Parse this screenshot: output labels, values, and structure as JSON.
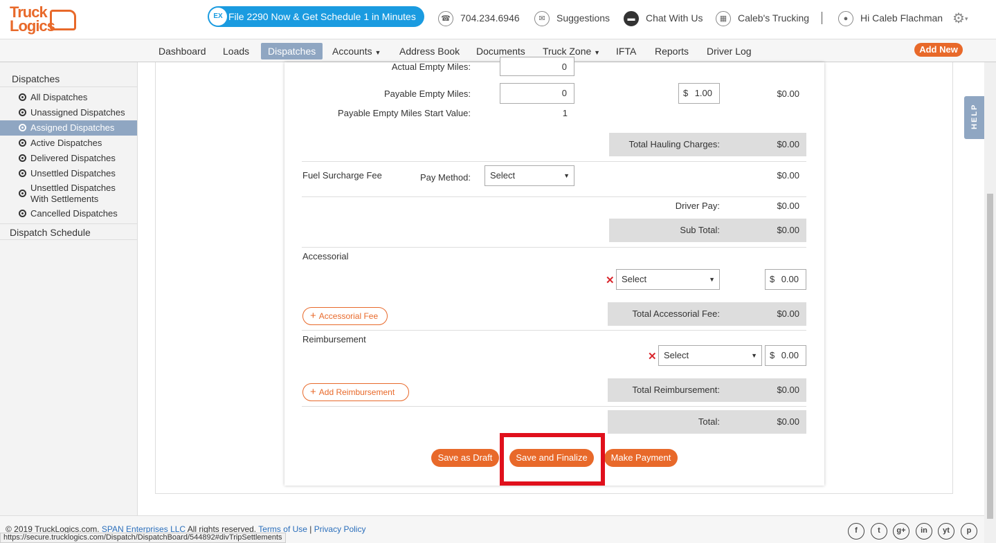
{
  "header": {
    "logo_line1": "Truck",
    "logo_line2": "Logics",
    "promo_badge": "EX",
    "promo": "File 2290 Now & Get Schedule 1 in Minutes",
    "phone": "704.234.6946",
    "suggestions": "Suggestions",
    "chat": "Chat With Us",
    "company": "Caleb's Trucking",
    "greeting": "Hi Caleb Flachman"
  },
  "nav": {
    "items": [
      "Dashboard",
      "Loads",
      "Dispatches",
      "Accounts",
      "Address Book",
      "Documents",
      "Truck Zone",
      "IFTA",
      "Reports",
      "Driver Log"
    ],
    "active": "Dispatches",
    "add_new": "Add New"
  },
  "sidebar": {
    "heading": "Dispatches",
    "items": [
      "All Dispatches",
      "Unassigned Dispatches",
      "Assigned Dispatches",
      "Active Dispatches",
      "Delivered Dispatches",
      "Unsettled Dispatches",
      "Unsettled Dispatches With Settlements",
      "Cancelled Dispatches"
    ],
    "active": "Assigned Dispatches",
    "schedule": "Dispatch Schedule"
  },
  "form": {
    "actual_empty_miles_label": "Actual Empty Miles:",
    "actual_empty_miles_value": "0",
    "payable_empty_miles_label": "Payable Empty Miles:",
    "payable_empty_miles_value": "0",
    "rate_symbol": "$",
    "rate_value": "1.00",
    "payable_amount": "$0.00",
    "start_value_label": "Payable Empty Miles Start Value:",
    "start_value": "1",
    "total_hauling_label": "Total Hauling Charges:",
    "total_hauling_value": "$0.00",
    "fuel_label": "Fuel Surcharge Fee",
    "pay_method_label": "Pay Method:",
    "pay_method_value": "Select",
    "fuel_amount": "$0.00",
    "driver_pay_label": "Driver Pay:",
    "driver_pay_value": "$0.00",
    "sub_total_label": "Sub Total:",
    "sub_total_value": "$0.00",
    "accessorial_label": "Accessorial",
    "accessorial_select": "Select",
    "accessorial_amount": "0.00",
    "add_accessorial": "Accessorial Fee",
    "total_accessorial_label": "Total Accessorial Fee:",
    "total_accessorial_value": "$0.00",
    "reimbursement_label": "Reimbursement",
    "reimbursement_select": "Select",
    "reimbursement_amount": "0.00",
    "add_reimbursement": "Add Reimbursement",
    "total_reimbursement_label": "Total Reimbursement:",
    "total_reimbursement_value": "$0.00",
    "total_label": "Total:",
    "total_value": "$0.00"
  },
  "actions": {
    "save_draft": "Save as Draft",
    "save_finalize": "Save and Finalize",
    "make_payment": "Make Payment"
  },
  "help": "HELP",
  "footer": {
    "copyright": "© 2019 TruckLogics.com.",
    "company": "SPAN Enterprises LLC",
    "rights": "All rights reserved.",
    "terms": "Terms of Use",
    "sep": "|",
    "privacy": "Privacy Policy",
    "social": [
      "f",
      "t",
      "g+",
      "in",
      "yt",
      "p"
    ]
  },
  "status_url": "https://secure.trucklogics.com/Dispatch/DispatchBoard/544892#divTripSettlements",
  "colors": {
    "accent": "#e8692a",
    "nav_active": "#8fa6c2",
    "promo": "#1a9be0",
    "highlight": "#e0101c"
  }
}
